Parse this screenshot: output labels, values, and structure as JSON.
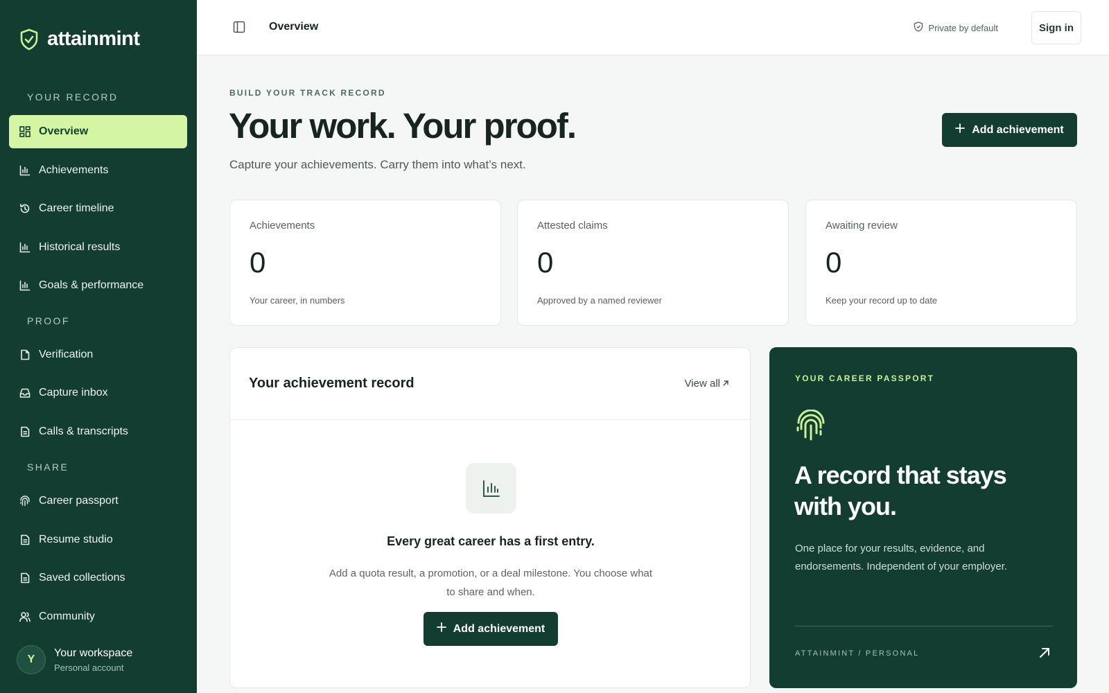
{
  "brand": {
    "name": "attainmint"
  },
  "sidebar": {
    "sections": {
      "record": "YOUR RECORD",
      "proof": "PROOF",
      "share": "SHARE"
    },
    "items": [
      {
        "label": "Overview",
        "icon": "dashboard-grid-icon"
      },
      {
        "label": "Achievements",
        "icon": "bar-chart-icon"
      },
      {
        "label": "Career timeline",
        "icon": "history-icon"
      },
      {
        "label": "Historical results",
        "icon": "bar-chart-icon"
      },
      {
        "label": "Goals & performance",
        "icon": "bar-chart-icon"
      },
      {
        "label": "Verification",
        "icon": "document-check-icon"
      },
      {
        "label": "Capture inbox",
        "icon": "inbox-icon"
      },
      {
        "label": "Calls & transcripts",
        "icon": "document-icon"
      },
      {
        "label": "Career passport",
        "icon": "fingerprint-icon"
      },
      {
        "label": "Resume studio",
        "icon": "document-icon"
      },
      {
        "label": "Saved collections",
        "icon": "document-icon"
      },
      {
        "label": "Community",
        "icon": "users-icon"
      }
    ],
    "workspace": {
      "initial": "Y",
      "name": "Your workspace",
      "type": "Personal account"
    }
  },
  "topbar": {
    "title": "Overview",
    "privacy": "Private by default",
    "sign_in": "Sign in"
  },
  "hero": {
    "eyebrow": "BUILD YOUR TRACK RECORD",
    "title": "Your work. Your proof.",
    "subtitle": "Capture your achievements. Carry them into what’s next.",
    "button": "Add achievement"
  },
  "stats": [
    {
      "label": "Achievements",
      "value": "0",
      "note": "Your career, in numbers"
    },
    {
      "label": "Attested claims",
      "value": "0",
      "note": "Approved by a named reviewer"
    },
    {
      "label": "Awaiting review",
      "value": "0",
      "note": "Keep your record up to date"
    }
  ],
  "record": {
    "title": "Your achievement record",
    "view_all": "View all",
    "empty_title": "Every great career has a first entry.",
    "empty_desc": "Add a quota result, a promotion, or a deal milestone. You choose what to share and when.",
    "button": "Add achievement"
  },
  "passport": {
    "eyebrow": "YOUR CAREER PASSPORT",
    "title": "A record that stays with you.",
    "desc": "One place for your results, evidence, and endorsements. Independent of your employer.",
    "footer": "ATTAINMINT / PERSONAL"
  },
  "colors": {
    "sidebar": "#133d31",
    "accent": "#d4f5a3",
    "primary": "#133d31",
    "background": "#f5f7f6"
  }
}
